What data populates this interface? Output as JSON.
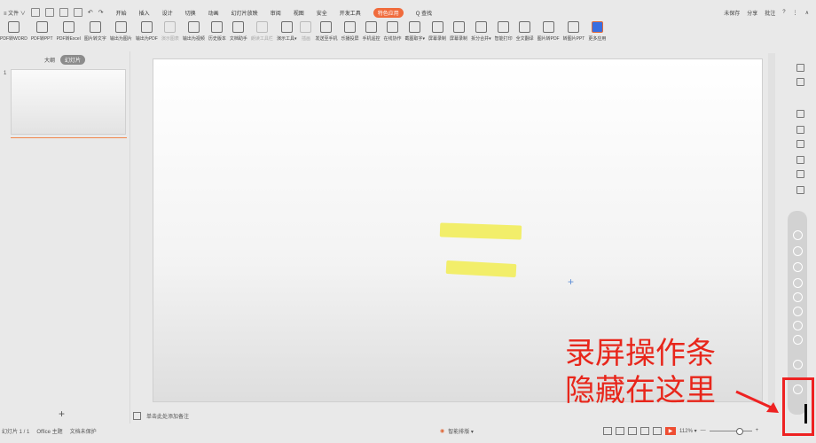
{
  "menubar": {
    "file_label": "≡ 文件 ∨",
    "tabs": [
      "开始",
      "插入",
      "设计",
      "切换",
      "动画",
      "幻灯片放映",
      "审阅",
      "视图",
      "安全",
      "开发工具",
      "特色应用",
      "Q 查找"
    ],
    "active_tab": "特色应用",
    "right": [
      "未保存",
      "分享",
      "批注",
      "?",
      "⋮",
      "∧"
    ]
  },
  "ribbon": {
    "buttons": [
      {
        "label": "PDF转WORD",
        "dim": false
      },
      {
        "label": "PDF转PPT",
        "dim": false
      },
      {
        "label": "PDF转Excel",
        "dim": false
      },
      {
        "label": "图片转文字",
        "dim": false
      },
      {
        "label": "输出为图片",
        "dim": false
      },
      {
        "label": "输出为PDF",
        "dim": false
      },
      {
        "label": "演示图表",
        "dim": true
      },
      {
        "label": "输出为视频",
        "dim": false
      },
      {
        "label": "历史版本",
        "dim": false
      },
      {
        "label": "文档助手",
        "dim": false
      },
      {
        "label": "朗读工具栏",
        "dim": true
      },
      {
        "label": "演示工具▾",
        "dim": false
      },
      {
        "label": "插画",
        "dim": true
      },
      {
        "label": "发送至手机",
        "dim": false
      },
      {
        "label": "乐播投屏",
        "dim": false
      },
      {
        "label": "手机遥控",
        "dim": false
      },
      {
        "label": "在线协作",
        "dim": false
      },
      {
        "label": "截图取字▾",
        "dim": false
      },
      {
        "label": "屏幕录制",
        "dim": false
      },
      {
        "label": "屏幕录制",
        "dim": false
      },
      {
        "label": "拆分合并▾",
        "dim": false
      },
      {
        "label": "智能打印",
        "dim": false
      },
      {
        "label": "全文翻译",
        "dim": false
      },
      {
        "label": "图片转PDF",
        "dim": false
      },
      {
        "label": "转图片PPT",
        "dim": false
      },
      {
        "label": "更多应用",
        "dim": false
      }
    ]
  },
  "left_panel": {
    "tab_outline": "大纲",
    "tab_slides": "幻灯片",
    "slide_number": "1",
    "add_button": "+"
  },
  "notes": {
    "placeholder": "单击此处添加备注"
  },
  "annotation": {
    "line1": "录屏操作条",
    "line2": "隐藏在这里"
  },
  "statusbar": {
    "slide_info": "幻灯片 1 / 1",
    "theme": "Office 主题",
    "protect": "文档未保护",
    "smart": "智能排版 ▾",
    "zoom": "112% ▾",
    "zoom_minus": "—",
    "zoom_plus": "+"
  }
}
